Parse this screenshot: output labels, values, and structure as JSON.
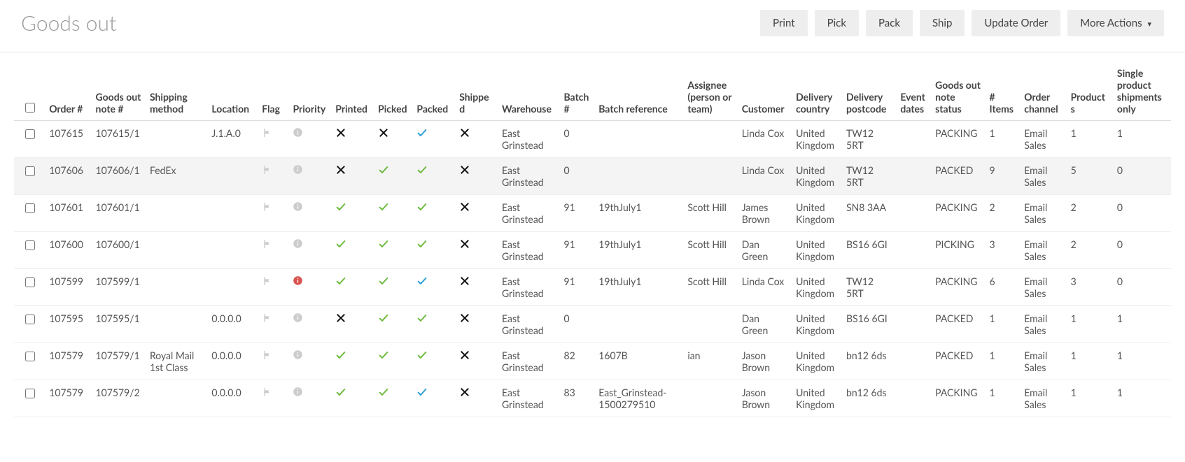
{
  "title": "Goods out",
  "actions": {
    "print": "Print",
    "pick": "Pick",
    "pack": "Pack",
    "ship": "Ship",
    "update": "Update Order",
    "more": "More Actions"
  },
  "columns": [
    "Order #",
    "Goods out note #",
    "Shipping method",
    "Location",
    "Flag",
    "Priority",
    "Printed",
    "Picked",
    "Packed",
    "Shipped",
    "Warehouse",
    "Batch #",
    "Batch reference",
    "Assignee (person or team)",
    "Customer",
    "Delivery country",
    "Delivery postcode",
    "Event dates",
    "Goods out note status",
    "# Items",
    "Order channel",
    "Products",
    "Single product shipments only"
  ],
  "rows": [
    {
      "order": "107615",
      "gon": "107615/1",
      "shipping": "",
      "location": "J.1.A.0",
      "priority": "grey",
      "printed": "x",
      "picked": "x",
      "packed": "blue",
      "shipped": "x",
      "warehouse": "East Grinstead",
      "batch": "0",
      "batchref": "",
      "assignee": "",
      "customer": "Linda Cox",
      "country": "United Kingdom",
      "postcode": "TW12 5RT",
      "eventdates": "",
      "status": "PACKING",
      "items": "1",
      "channel": "Email Sales",
      "products": "1",
      "single": "1",
      "hover": false
    },
    {
      "order": "107606",
      "gon": "107606/1",
      "shipping": "FedEx",
      "location": "",
      "priority": "grey",
      "printed": "x",
      "picked": "green",
      "packed": "green",
      "shipped": "x",
      "warehouse": "East Grinstead",
      "batch": "0",
      "batchref": "",
      "assignee": "",
      "customer": "Linda Cox",
      "country": "United Kingdom",
      "postcode": "TW12 5RT",
      "eventdates": "",
      "status": "PACKED",
      "items": "9",
      "channel": "Email Sales",
      "products": "5",
      "single": "0",
      "hover": true
    },
    {
      "order": "107601",
      "gon": "107601/1",
      "shipping": "",
      "location": "",
      "priority": "grey",
      "printed": "green",
      "picked": "green",
      "packed": "green",
      "shipped": "x",
      "warehouse": "East Grinstead",
      "batch": "91",
      "batchref": "19thJuly1",
      "assignee": "Scott Hill",
      "customer": "James Brown",
      "country": "United Kingdom",
      "postcode": "SN8 3AA",
      "eventdates": "",
      "status": "PACKING",
      "items": "2",
      "channel": "Email Sales",
      "products": "2",
      "single": "0",
      "hover": false
    },
    {
      "order": "107600",
      "gon": "107600/1",
      "shipping": "",
      "location": "",
      "priority": "grey",
      "printed": "green",
      "picked": "green",
      "packed": "green",
      "shipped": "x",
      "warehouse": "East Grinstead",
      "batch": "91",
      "batchref": "19thJuly1",
      "assignee": "Scott Hill",
      "customer": "Dan Green",
      "country": "United Kingdom",
      "postcode": "BS16 6GI",
      "eventdates": "",
      "status": "PICKING",
      "items": "3",
      "channel": "Email Sales",
      "products": "2",
      "single": "0",
      "hover": false
    },
    {
      "order": "107599",
      "gon": "107599/1",
      "shipping": "",
      "location": "",
      "priority": "red",
      "printed": "green",
      "picked": "green",
      "packed": "blue",
      "shipped": "x",
      "warehouse": "East Grinstead",
      "batch": "91",
      "batchref": "19thJuly1",
      "assignee": "Scott Hill",
      "customer": "Linda Cox",
      "country": "United Kingdom",
      "postcode": "TW12 5RT",
      "eventdates": "",
      "status": "PACKING",
      "items": "6",
      "channel": "Email Sales",
      "products": "3",
      "single": "0",
      "hover": false
    },
    {
      "order": "107595",
      "gon": "107595/1",
      "shipping": "",
      "location": "0.0.0.0",
      "priority": "grey",
      "printed": "x",
      "picked": "green",
      "packed": "green",
      "shipped": "x",
      "warehouse": "East Grinstead",
      "batch": "0",
      "batchref": "",
      "assignee": "",
      "customer": "Dan Green",
      "country": "United Kingdom",
      "postcode": "BS16 6GI",
      "eventdates": "",
      "status": "PACKED",
      "items": "1",
      "channel": "Email Sales",
      "products": "1",
      "single": "1",
      "hover": false
    },
    {
      "order": "107579",
      "gon": "107579/1",
      "shipping": "Royal Mail 1st Class",
      "location": "0.0.0.0",
      "priority": "grey",
      "printed": "green",
      "picked": "green",
      "packed": "green",
      "shipped": "x",
      "warehouse": "East Grinstead",
      "batch": "82",
      "batchref": "1607B",
      "assignee": "ian",
      "customer": "Jason Brown",
      "country": "United Kingdom",
      "postcode": "bn12 6ds",
      "eventdates": "",
      "status": "PACKED",
      "items": "1",
      "channel": "Email Sales",
      "products": "1",
      "single": "1",
      "hover": false
    },
    {
      "order": "107579",
      "gon": "107579/2",
      "shipping": "",
      "location": "0.0.0.0",
      "priority": "grey",
      "printed": "green",
      "picked": "green",
      "packed": "blue",
      "shipped": "x",
      "warehouse": "East Grinstead",
      "batch": "83",
      "batchref": "East_Grinstead-1500279510",
      "assignee": "",
      "customer": "Jason Brown",
      "country": "United Kingdom",
      "postcode": "bn12 6ds",
      "eventdates": "",
      "status": "PACKING",
      "items": "1",
      "channel": "Email Sales",
      "products": "1",
      "single": "1",
      "hover": false
    }
  ]
}
